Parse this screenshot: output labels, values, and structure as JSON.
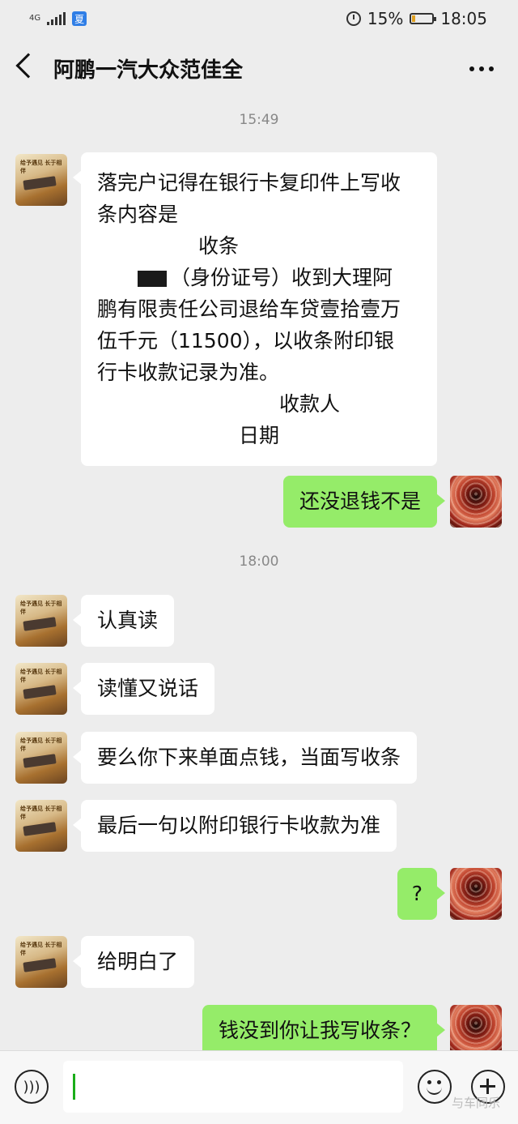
{
  "status_bar": {
    "network": "4G",
    "app_badge": "夏",
    "battery": "15%",
    "battery_level": 0.15,
    "time": "18:05"
  },
  "header": {
    "title": "阿鹏一汽大众范佳全"
  },
  "timestamps": [
    "15:49",
    "18:00"
  ],
  "avatar_them_text": "给予遇见 长于相伴",
  "messages": [
    {
      "side": "in",
      "lines": [
        "落完户记得在银行卡复印件上写收",
        "条内容是",
        "　　　　　收条",
        "（身份证号）收到大理阿",
        "鹏有限责任公司退给车贷壹拾壹万",
        "伍千元（11500），以收条附印银",
        "行卡收款记录为准。",
        "　　　　　　　　　收款人",
        "　　　　　　　日期"
      ]
    },
    {
      "side": "out",
      "text": "还没退钱不是"
    },
    {
      "side": "in",
      "text": "认真读"
    },
    {
      "side": "in",
      "text": "读懂又说话"
    },
    {
      "side": "in",
      "text": "要么你下来单面点钱，当面写收条"
    },
    {
      "side": "in",
      "text": "最后一句以附印银行卡收款为准"
    },
    {
      "side": "out",
      "text": "?"
    },
    {
      "side": "in",
      "text": "给明白了"
    },
    {
      "side": "out",
      "text": "钱没到你让我写收条？"
    }
  ],
  "input": {
    "value": ""
  },
  "watermark": "与车同乐"
}
